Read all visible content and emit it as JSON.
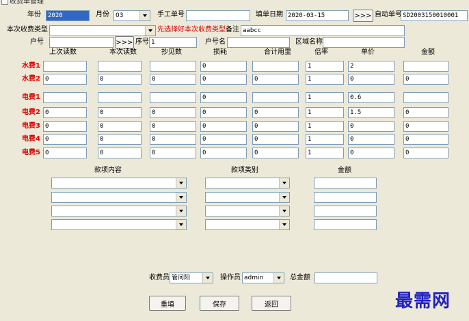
{
  "window": {
    "title": "收费单管理"
  },
  "header": {
    "year_label": "年份",
    "year_value": "2020",
    "month_label": "月份",
    "month_value": "03",
    "manual_no_label": "手工单号",
    "manual_no_value": "",
    "date_label": "填单日期",
    "date_value": "2020-03-15",
    "auto_no_button": ">>>",
    "auto_no_label": "自动单号",
    "auto_no_value": "SD2003150010001",
    "fee_type_label": "本次收费类型",
    "fee_type_value": "",
    "fee_type_hint": "先选择好本次收费类型",
    "remark_label": "备注",
    "remark_value": "aabcc",
    "account_label": "户号",
    "account_value": "",
    "account_button": ">>>",
    "seq_label": "序号",
    "seq_value": "1",
    "account_name_label": "户号名",
    "account_name_value": "",
    "area_label": "区域名称",
    "area_value": ""
  },
  "meter_table": {
    "columns": [
      "上次读数",
      "本次读数",
      "抄见数",
      "损耗",
      "合计用里",
      "倍率",
      "单价",
      "金额"
    ],
    "rows": [
      {
        "label": "水费1",
        "cells": [
          "",
          "",
          "",
          "0",
          "",
          "1",
          "2",
          ""
        ]
      },
      {
        "label": "水费2",
        "cells": [
          "0",
          "0",
          "0",
          "0",
          "0",
          "1",
          "0",
          "0"
        ]
      },
      {
        "label": "电费1",
        "cells": [
          "",
          "",
          "",
          "0",
          "",
          "1",
          "0.6",
          ""
        ]
      },
      {
        "label": "电费2",
        "cells": [
          "0",
          "0",
          "0",
          "0",
          "0",
          "1",
          "1.5",
          "0"
        ]
      },
      {
        "label": "电费3",
        "cells": [
          "0",
          "0",
          "0",
          "0",
          "0",
          "1",
          "0",
          "0"
        ]
      },
      {
        "label": "电费4",
        "cells": [
          "0",
          "0",
          "0",
          "0",
          "0",
          "1",
          "0",
          "0"
        ]
      },
      {
        "label": "电费5",
        "cells": [
          "0",
          "0",
          "0",
          "0",
          "0",
          "1",
          "0",
          "0"
        ]
      }
    ]
  },
  "items_table": {
    "columns": [
      "款项内容",
      "款项类别",
      "金额"
    ],
    "rows": [
      {
        "content": "",
        "category": "",
        "amount": ""
      },
      {
        "content": "",
        "category": "",
        "amount": ""
      },
      {
        "content": "",
        "category": "",
        "amount": ""
      },
      {
        "content": "",
        "category": "",
        "amount": ""
      }
    ]
  },
  "footer": {
    "collector_label": "收费员",
    "collector_value": "管问阳",
    "operator_label": "操作员",
    "operator_value": "admin",
    "total_label": "总金额",
    "total_value": "",
    "reset_button": "重填",
    "save_button": "保存",
    "back_button": "返回"
  },
  "watermark": "最需网"
}
